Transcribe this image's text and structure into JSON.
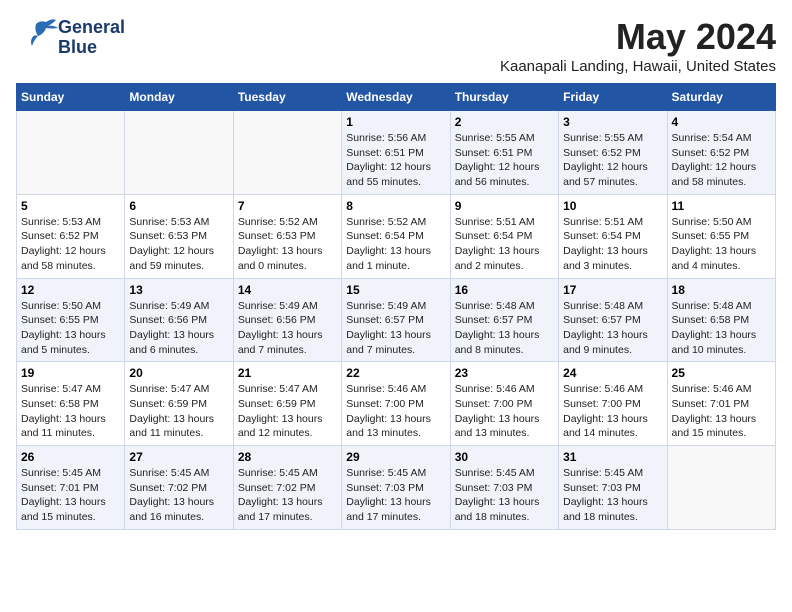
{
  "logo": {
    "line1": "General",
    "line2": "Blue"
  },
  "title": "May 2024",
  "subtitle": "Kaanapali Landing, Hawaii, United States",
  "days_of_week": [
    "Sunday",
    "Monday",
    "Tuesday",
    "Wednesday",
    "Thursday",
    "Friday",
    "Saturday"
  ],
  "weeks": [
    [
      {
        "day": "",
        "info": ""
      },
      {
        "day": "",
        "info": ""
      },
      {
        "day": "",
        "info": ""
      },
      {
        "day": "1",
        "info": "Sunrise: 5:56 AM\nSunset: 6:51 PM\nDaylight: 12 hours\nand 55 minutes."
      },
      {
        "day": "2",
        "info": "Sunrise: 5:55 AM\nSunset: 6:51 PM\nDaylight: 12 hours\nand 56 minutes."
      },
      {
        "day": "3",
        "info": "Sunrise: 5:55 AM\nSunset: 6:52 PM\nDaylight: 12 hours\nand 57 minutes."
      },
      {
        "day": "4",
        "info": "Sunrise: 5:54 AM\nSunset: 6:52 PM\nDaylight: 12 hours\nand 58 minutes."
      }
    ],
    [
      {
        "day": "5",
        "info": "Sunrise: 5:53 AM\nSunset: 6:52 PM\nDaylight: 12 hours\nand 58 minutes."
      },
      {
        "day": "6",
        "info": "Sunrise: 5:53 AM\nSunset: 6:53 PM\nDaylight: 12 hours\nand 59 minutes."
      },
      {
        "day": "7",
        "info": "Sunrise: 5:52 AM\nSunset: 6:53 PM\nDaylight: 13 hours\nand 0 minutes."
      },
      {
        "day": "8",
        "info": "Sunrise: 5:52 AM\nSunset: 6:54 PM\nDaylight: 13 hours\nand 1 minute."
      },
      {
        "day": "9",
        "info": "Sunrise: 5:51 AM\nSunset: 6:54 PM\nDaylight: 13 hours\nand 2 minutes."
      },
      {
        "day": "10",
        "info": "Sunrise: 5:51 AM\nSunset: 6:54 PM\nDaylight: 13 hours\nand 3 minutes."
      },
      {
        "day": "11",
        "info": "Sunrise: 5:50 AM\nSunset: 6:55 PM\nDaylight: 13 hours\nand 4 minutes."
      }
    ],
    [
      {
        "day": "12",
        "info": "Sunrise: 5:50 AM\nSunset: 6:55 PM\nDaylight: 13 hours\nand 5 minutes."
      },
      {
        "day": "13",
        "info": "Sunrise: 5:49 AM\nSunset: 6:56 PM\nDaylight: 13 hours\nand 6 minutes."
      },
      {
        "day": "14",
        "info": "Sunrise: 5:49 AM\nSunset: 6:56 PM\nDaylight: 13 hours\nand 7 minutes."
      },
      {
        "day": "15",
        "info": "Sunrise: 5:49 AM\nSunset: 6:57 PM\nDaylight: 13 hours\nand 7 minutes."
      },
      {
        "day": "16",
        "info": "Sunrise: 5:48 AM\nSunset: 6:57 PM\nDaylight: 13 hours\nand 8 minutes."
      },
      {
        "day": "17",
        "info": "Sunrise: 5:48 AM\nSunset: 6:57 PM\nDaylight: 13 hours\nand 9 minutes."
      },
      {
        "day": "18",
        "info": "Sunrise: 5:48 AM\nSunset: 6:58 PM\nDaylight: 13 hours\nand 10 minutes."
      }
    ],
    [
      {
        "day": "19",
        "info": "Sunrise: 5:47 AM\nSunset: 6:58 PM\nDaylight: 13 hours\nand 11 minutes."
      },
      {
        "day": "20",
        "info": "Sunrise: 5:47 AM\nSunset: 6:59 PM\nDaylight: 13 hours\nand 11 minutes."
      },
      {
        "day": "21",
        "info": "Sunrise: 5:47 AM\nSunset: 6:59 PM\nDaylight: 13 hours\nand 12 minutes."
      },
      {
        "day": "22",
        "info": "Sunrise: 5:46 AM\nSunset: 7:00 PM\nDaylight: 13 hours\nand 13 minutes."
      },
      {
        "day": "23",
        "info": "Sunrise: 5:46 AM\nSunset: 7:00 PM\nDaylight: 13 hours\nand 13 minutes."
      },
      {
        "day": "24",
        "info": "Sunrise: 5:46 AM\nSunset: 7:00 PM\nDaylight: 13 hours\nand 14 minutes."
      },
      {
        "day": "25",
        "info": "Sunrise: 5:46 AM\nSunset: 7:01 PM\nDaylight: 13 hours\nand 15 minutes."
      }
    ],
    [
      {
        "day": "26",
        "info": "Sunrise: 5:45 AM\nSunset: 7:01 PM\nDaylight: 13 hours\nand 15 minutes."
      },
      {
        "day": "27",
        "info": "Sunrise: 5:45 AM\nSunset: 7:02 PM\nDaylight: 13 hours\nand 16 minutes."
      },
      {
        "day": "28",
        "info": "Sunrise: 5:45 AM\nSunset: 7:02 PM\nDaylight: 13 hours\nand 17 minutes."
      },
      {
        "day": "29",
        "info": "Sunrise: 5:45 AM\nSunset: 7:03 PM\nDaylight: 13 hours\nand 17 minutes."
      },
      {
        "day": "30",
        "info": "Sunrise: 5:45 AM\nSunset: 7:03 PM\nDaylight: 13 hours\nand 18 minutes."
      },
      {
        "day": "31",
        "info": "Sunrise: 5:45 AM\nSunset: 7:03 PM\nDaylight: 13 hours\nand 18 minutes."
      },
      {
        "day": "",
        "info": ""
      }
    ]
  ]
}
